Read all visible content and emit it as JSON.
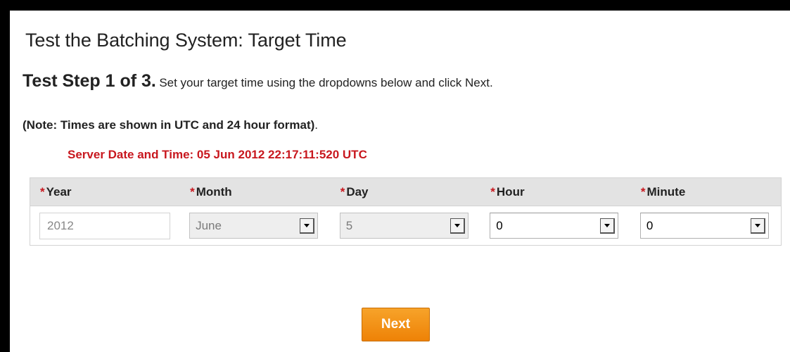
{
  "page": {
    "title": "Test the Batching System: Target Time",
    "step_label": "Test Step 1 of 3.",
    "step_text": "Set your target time using the dropdowns below and click Next.",
    "note_bold": "(Note: Times are shown in UTC and 24 hour format)",
    "note_tail": ".",
    "server_time": "Server Date and Time: 05 Jun 2012 22:17:11:520 UTC"
  },
  "table": {
    "required_marker": "*",
    "columns": [
      {
        "label": "Year"
      },
      {
        "label": "Month"
      },
      {
        "label": "Day"
      },
      {
        "label": "Hour"
      },
      {
        "label": "Minute"
      }
    ],
    "values": {
      "year": "2012",
      "month": "June",
      "day": "5",
      "hour": "0",
      "minute": "0"
    }
  },
  "actions": {
    "next_label": "Next"
  },
  "colors": {
    "required": "#c8171e",
    "server_time": "#c8171e",
    "button": "#ee8206",
    "header_bg": "#e3e3e3"
  },
  "icons": {
    "dropdown": "chevron-down-icon"
  }
}
